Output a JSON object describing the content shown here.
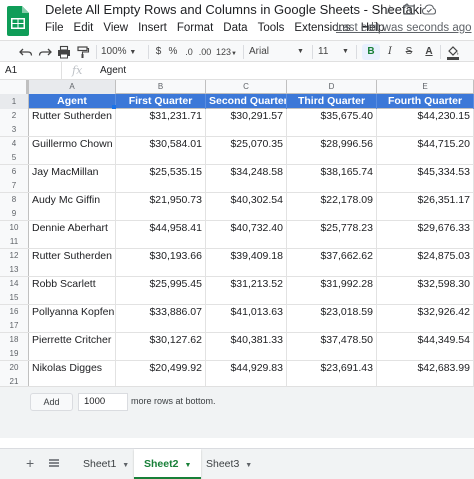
{
  "window": {
    "doc_title": "Delete All Empty Rows and Columns in Google Sheets - Sheetaki",
    "last_edit": "Last edit was seconds ago"
  },
  "menu": [
    "File",
    "Edit",
    "View",
    "Insert",
    "Format",
    "Data",
    "Tools",
    "Extensions",
    "Help"
  ],
  "toolbar": {
    "zoom": "100%",
    "currency": "$",
    "percent": "%",
    "dec_decrease": ".0",
    "dec_increase": ".00",
    "more_formats": "123",
    "font": "Arial",
    "font_size": "11",
    "bold": "B",
    "italic": "I",
    "strike": "S",
    "text_color": "A"
  },
  "formula_bar": {
    "cell_ref": "A1",
    "fx": "fx",
    "value": "Agent"
  },
  "columns": [
    "A",
    "B",
    "C",
    "D",
    "E"
  ],
  "header_row": {
    "row_num": "1",
    "cells": [
      "Agent",
      "First Quarter",
      "Second Quarter",
      "Third Quarter",
      "Fourth Quarter"
    ]
  },
  "rows": [
    {
      "nums": [
        "2",
        "3"
      ],
      "cells": [
        "Rutter Sutherden",
        "$31,231.71",
        "$30,291.57",
        "$35,675.40",
        "$44,230.15"
      ]
    },
    {
      "nums": [
        "4",
        "5"
      ],
      "cells": [
        "Guillermo Chown",
        "$30,584.01",
        "$25,070.35",
        "$28,996.56",
        "$44,715.20"
      ]
    },
    {
      "nums": [
        "6",
        "7"
      ],
      "cells": [
        "Jay MacMillan",
        "$25,535.15",
        "$34,248.58",
        "$38,165.74",
        "$45,334.53"
      ]
    },
    {
      "nums": [
        "8",
        "9"
      ],
      "cells": [
        "Audy Mc Giffin",
        "$21,950.73",
        "$40,302.54",
        "$22,178.09",
        "$26,351.17"
      ]
    },
    {
      "nums": [
        "10",
        "11"
      ],
      "cells": [
        "Dennie Aberhart",
        "$44,958.41",
        "$40,732.40",
        "$25,778.23",
        "$29,676.33"
      ]
    },
    {
      "nums": [
        "12",
        "13"
      ],
      "cells": [
        "Rutter Sutherden",
        "$30,193.66",
        "$39,409.18",
        "$37,662.62",
        "$24,875.03"
      ]
    },
    {
      "nums": [
        "14",
        "15"
      ],
      "cells": [
        "Robb Scarlett",
        "$25,995.45",
        "$31,213.52",
        "$31,992.28",
        "$32,598.30"
      ]
    },
    {
      "nums": [
        "16",
        "17"
      ],
      "cells": [
        "Pollyanna Kopfen",
        "$33,886.07",
        "$41,013.63",
        "$23,018.59",
        "$32,926.42"
      ]
    },
    {
      "nums": [
        "18",
        "19"
      ],
      "cells": [
        "Pierrette Critcher",
        "$30,127.62",
        "$40,381.33",
        "$37,478.50",
        "$44,349.54"
      ]
    },
    {
      "nums": [
        "20",
        "21"
      ],
      "cells": [
        "Nikolas Digges",
        "$20,499.92",
        "$44,929.83",
        "$23,691.43",
        "$42,683.99"
      ]
    }
  ],
  "add_rows": {
    "button": "Add",
    "count": "1000",
    "text": "more rows at bottom."
  },
  "sheets": [
    {
      "name": "Sheet1",
      "active": false
    },
    {
      "name": "Sheet2",
      "active": true
    },
    {
      "name": "Sheet3",
      "active": false
    }
  ],
  "colors": {
    "header_fill": "#3c78d8",
    "sheets_green": "#188038",
    "accent_blue": "#1a73e8"
  }
}
